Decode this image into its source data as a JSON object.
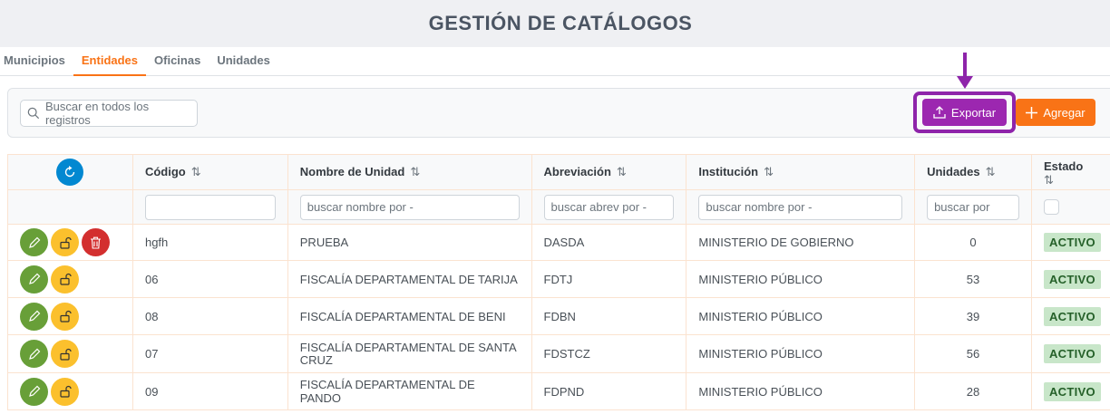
{
  "page": {
    "title": "GESTIÓN DE CATÁLOGOS"
  },
  "tabs": [
    {
      "label": "Municipios",
      "active": false
    },
    {
      "label": "Entidades",
      "active": true
    },
    {
      "label": "Oficinas",
      "active": false
    },
    {
      "label": "Unidades",
      "active": false
    }
  ],
  "toolbar": {
    "search_placeholder": "Buscar en todos los registros",
    "export_label": "Exportar",
    "add_label": "Agregar"
  },
  "colors": {
    "accent": "#f97316",
    "export": "#9c27b0",
    "highlight": "#8e24aa",
    "active_badge_bg": "#c8e6c9",
    "active_badge_text": "#256029"
  },
  "table": {
    "columns": {
      "codigo": "Código",
      "nombre": "Nombre de Unidad",
      "abreviacion": "Abreviación",
      "institucion": "Institución",
      "unidades": "Unidades",
      "estado": "Estado"
    },
    "filters": {
      "codigo": "",
      "nombre": "buscar nombre por -",
      "abreviacion": "buscar abrev por -",
      "institucion": "buscar nombre por -",
      "unidades": "buscar por"
    },
    "rows": [
      {
        "codigo": "hgfh",
        "nombre": "PRUEBA",
        "abreviacion": "DASDA",
        "institucion": "MINISTERIO DE GOBIERNO",
        "unidades": "0",
        "estado": "ACTIVO"
      },
      {
        "codigo": "06",
        "nombre": "FISCALÍA DEPARTAMENTAL DE TARIJA",
        "abreviacion": "FDTJ",
        "institucion": "MINISTERIO PÚBLICO",
        "unidades": "53",
        "estado": "ACTIVO"
      },
      {
        "codigo": "08",
        "nombre": "FISCALÍA DEPARTAMENTAL DE BENI",
        "abreviacion": "FDBN",
        "institucion": "MINISTERIO PÚBLICO",
        "unidades": "39",
        "estado": "ACTIVO"
      },
      {
        "codigo": "07",
        "nombre": "FISCALÍA DEPARTAMENTAL DE SANTA CRUZ",
        "abreviacion": "FDSTCZ",
        "institucion": "MINISTERIO PÚBLICO",
        "unidades": "56",
        "estado": "ACTIVO"
      },
      {
        "codigo": "09",
        "nombre": "FISCALÍA DEPARTAMENTAL DE PANDO",
        "abreviacion": "FDPND",
        "institucion": "MINISTERIO PÚBLICO",
        "unidades": "28",
        "estado": "ACTIVO"
      }
    ]
  },
  "icons": [
    "refresh-icon",
    "search-icon",
    "upload-icon",
    "plus-icon",
    "pencil-icon",
    "unlock-icon",
    "trash-icon",
    "sort-icon",
    "arrow-down-icon"
  ]
}
